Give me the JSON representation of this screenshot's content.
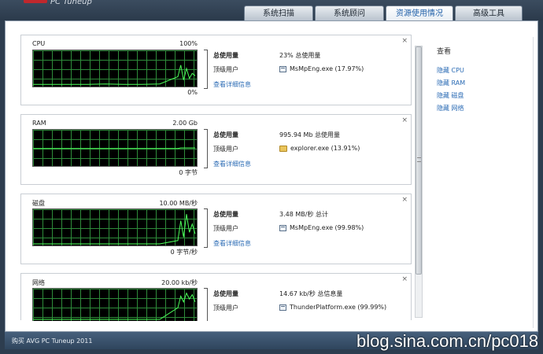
{
  "app": {
    "title": "PC Tuneup"
  },
  "tabs": [
    {
      "label": "系统扫描",
      "active": false
    },
    {
      "label": "系统顾问",
      "active": false
    },
    {
      "label": "资源使用情况",
      "active": true
    },
    {
      "label": "高级工具",
      "active": false
    }
  ],
  "cards": [
    {
      "label": "CPU",
      "max": "100%",
      "min": "0%",
      "total_key": "总使用量",
      "total_value": "23% 总使用量",
      "top_key": "顶级用户",
      "top_value": "MsMpEng.exe (17.97%)",
      "top_icon": "process-icon",
      "detail": "查看详细信息",
      "close": "×",
      "usage_history": [
        0.02,
        0.02,
        0.02,
        0.02,
        0.03,
        0.02,
        0.02,
        0.03,
        0.25,
        0.6,
        0.15,
        0.5,
        0.2,
        0.35,
        0.28
      ]
    },
    {
      "label": "RAM",
      "max": "2.00 Gb",
      "min": "0 字节",
      "total_key": "总使用量",
      "total_value": "995.94 Mb 总使用量",
      "top_key": "顶级用户",
      "top_value": "explorer.exe (13.91%)",
      "top_icon": "folder-icon",
      "detail": "查看详细信息",
      "close": "×",
      "usage_history": [
        0.48,
        0.48,
        0.48,
        0.48,
        0.48,
        0.48,
        0.48,
        0.48,
        0.48,
        0.5,
        0.5,
        0.5,
        0.5,
        0.5,
        0.5
      ]
    },
    {
      "label": "磁盘",
      "max": "10.00 MB/秒",
      "min": "0 字节/秒",
      "total_key": "总使用量",
      "total_value": "3.48 MB/秒 总计",
      "top_key": "顶级用户",
      "top_value": "MsMpEng.exe (99.98%)",
      "top_icon": "process-icon",
      "detail": "查看详细信息",
      "close": "×",
      "usage_history": [
        0.0,
        0.0,
        0.0,
        0.0,
        0.0,
        0.0,
        0.0,
        0.0,
        0.1,
        0.7,
        0.2,
        0.9,
        0.35,
        0.6,
        0.3
      ]
    },
    {
      "label": "网络",
      "max": "20.00 kb/秒",
      "min": "",
      "total_key": "总使用量",
      "total_value": "14.67 kb/秒 总信息量",
      "top_key": "顶级用户",
      "top_value": "ThunderPlatform.exe (99.99%)",
      "top_icon": "process-icon",
      "detail": "",
      "close": "×",
      "usage_history": [
        0.0,
        0.0,
        0.0,
        0.0,
        0.0,
        0.0,
        0.0,
        0.0,
        0.4,
        0.8,
        0.6,
        0.9,
        0.7,
        0.85,
        0.6
      ]
    }
  ],
  "sidebar": {
    "title": "查看",
    "links": [
      "隐藏 CPU",
      "隐藏 RAM",
      "隐藏 磁盘",
      "隐藏 网络"
    ]
  },
  "footer": {
    "buy": "购买 AVG PC Tuneup 2011"
  },
  "watermark": "blog.sina.com.cn/pc018"
}
